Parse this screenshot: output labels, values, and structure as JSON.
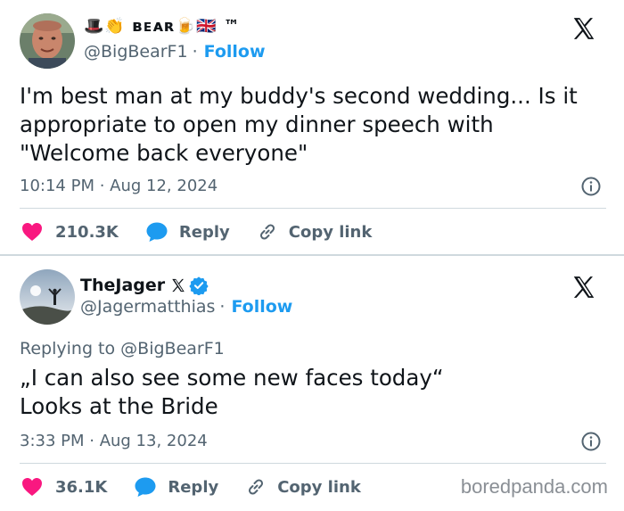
{
  "tweets": [
    {
      "display_name": "🎩👏 ʙᴇᴀʀ🍺🇬🇧 ™",
      "handle": "@BigBearF1",
      "follow_label": "Follow",
      "text": "I'm best man at my buddy's second wedding... Is it\nappropriate to open my dinner speech with\n\"Welcome back everyone\"",
      "timestamp": "10:14 PM · Aug 12, 2024",
      "likes": "210.3K",
      "reply_label": "Reply",
      "copy_label": "Copy link"
    },
    {
      "display_name": "TheJager",
      "handle": "@Jagermatthias",
      "follow_label": "Follow",
      "replying_prefix": "Replying to",
      "replying_to": "@BigBearF1",
      "text": "„I can also see some new faces today“\nLooks at the Bride",
      "timestamp": "3:33 PM · Aug 13, 2024",
      "likes": "36.1K",
      "reply_label": "Reply",
      "copy_label": "Copy link"
    }
  ],
  "watermark": "boredpanda.com",
  "colors": {
    "like": "#f91880",
    "reply": "#1d9bf0",
    "follow": "#1d9bf0",
    "verified": "#1d9bf0",
    "secondary_text": "#536471"
  }
}
